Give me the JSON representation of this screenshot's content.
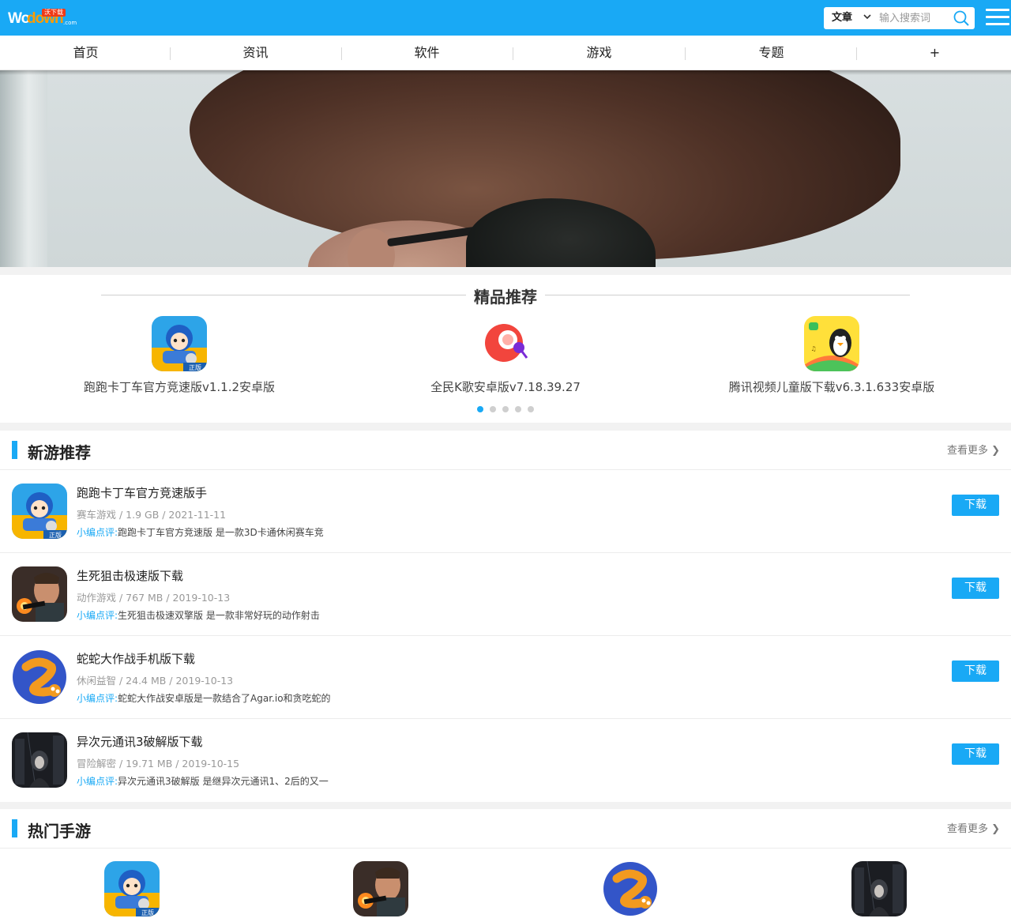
{
  "header": {
    "logo_wo": "Wo",
    "logo_down": "down",
    "logo_com": ".com",
    "logo_badge": "沃下载",
    "search_type": "文章",
    "search_placeholder": "输入搜索词"
  },
  "nav": {
    "items": [
      "首页",
      "资讯",
      "软件",
      "游戏",
      "专题",
      "+"
    ]
  },
  "featured": {
    "title": "精品推荐",
    "apps": [
      {
        "name": "跑跑卡丁车官方竞速版v1.1.2安卓版",
        "icon": "kart-racer-icon"
      },
      {
        "name": "全民K歌安卓版v7.18.39.27",
        "icon": "karaoke-icon"
      },
      {
        "name": "腾讯视频儿童版下载v6.3.1.633安卓版",
        "icon": "penguin-kids-icon"
      }
    ],
    "dots": 5,
    "active_dot": 0
  },
  "new_games": {
    "title": "新游推荐",
    "more": "查看更多",
    "comment_label": "小编点评:",
    "download_label": "下载",
    "items": [
      {
        "name": "跑跑卡丁车官方竞速版手",
        "meta": "赛车游戏 / 1.9 GB / 2021-11-11",
        "comment": "跑跑卡丁车官方竞速版 是一款3D卡通休闲赛车竞",
        "icon": "kart-racer-icon"
      },
      {
        "name": "生死狙击极速版下载",
        "meta": "动作游戏 / 767 MB / 2019-10-13",
        "comment": "生死狙击极速双擎版 是一款非常好玩的动作射击",
        "icon": "shooter-soldier-icon"
      },
      {
        "name": "蛇蛇大作战手机版下载",
        "meta": "休闲益智 / 24.4 MB / 2019-10-13",
        "comment": "蛇蛇大作战安卓版是一款结合了Agar.io和贪吃蛇的",
        "icon": "snake-icon"
      },
      {
        "name": "异次元通讯3破解版下载",
        "meta": "冒险解密 / 19.71 MB / 2019-10-15",
        "comment": "异次元通讯3破解版 是继异次元通讯1、2后的又一",
        "icon": "dark-girl-icon"
      }
    ]
  },
  "hot_games": {
    "title": "热门手游",
    "more": "查看更多",
    "icons": [
      "kart-racer-icon",
      "shooter-soldier-icon",
      "snake-icon",
      "dark-girl-icon"
    ]
  },
  "colors": {
    "accent": "#19a9f5",
    "logo_orange": "#ff9c00"
  }
}
